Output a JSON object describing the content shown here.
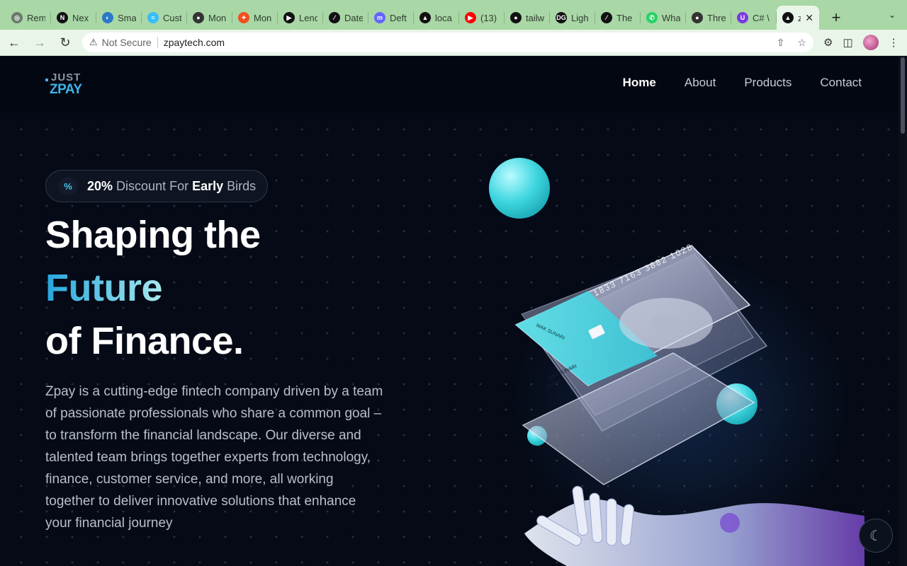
{
  "browser": {
    "tabs": [
      {
        "title": "Rem",
        "icon": "chatgpt-icon",
        "color": "#6b7b6b"
      },
      {
        "title": "Nex",
        "icon": "notion-icon",
        "color": "#111111"
      },
      {
        "title": "Sma",
        "icon": "globe-blue-icon",
        "color": "#2a78c8"
      },
      {
        "title": "Cust",
        "icon": "tailwind-icon",
        "color": "#38bdf8"
      },
      {
        "title": "Mon",
        "icon": "globe-icon",
        "color": "#333333"
      },
      {
        "title": "Mon",
        "icon": "figma-icon",
        "color": "#f24e1e"
      },
      {
        "title": "Lenc",
        "icon": "play-icon",
        "color": "#111111"
      },
      {
        "title": "Date",
        "icon": "slash-icon",
        "color": "#111111"
      },
      {
        "title": "Deft",
        "icon": "mastodon-icon",
        "color": "#6364ff"
      },
      {
        "title": "loca",
        "icon": "triangle-icon",
        "color": "#111111"
      },
      {
        "title": "(13)",
        "icon": "youtube-icon",
        "color": "#ff0000"
      },
      {
        "title": "tailw",
        "icon": "github-icon",
        "color": "#111111"
      },
      {
        "title": "Ligh",
        "icon": "dg-icon",
        "color": "#111111"
      },
      {
        "title": "The",
        "icon": "slash-icon",
        "color": "#111111"
      },
      {
        "title": "Wha",
        "icon": "whatsapp-icon",
        "color": "#25d366"
      },
      {
        "title": "Thre",
        "icon": "globe-icon",
        "color": "#333333"
      },
      {
        "title": "C# \\",
        "icon": "u-icon",
        "color": "#7a3be0"
      },
      {
        "title": "z",
        "icon": "triangle-icon",
        "color": "#111111",
        "active": true
      }
    ],
    "new_tab": "+",
    "tab_menu": "⌄",
    "security_label": "Not Secure",
    "url": "zpaytech.com"
  },
  "site": {
    "logo_top": "JUST",
    "logo_bottom": "ZPAY",
    "nav": [
      "Home",
      "About",
      "Products",
      "Contact"
    ],
    "badge": {
      "icon": "percent-icon",
      "part1": "20%",
      "part2": "Discount For",
      "part3": "Early",
      "part4": "Birds"
    },
    "hero_line1": "Shaping the",
    "hero_line2": "Future",
    "hero_line3": "of Finance.",
    "description": "Zpay is a cutting-edge fintech company driven by a team of passionate professionals who share a common goal – to transform the financial landscape. Our diverse and talented team brings together experts from technology, finance, customer service, and more, all working together to deliver innovative solutions that enhance your financial journey",
    "card_number": "1833 7163 3882 1028",
    "card_name": "WAK SUNARI",
    "card_exp": "09/2024",
    "accent": "#3fd6e0",
    "theme_toggle_icon": "moon-icon"
  }
}
